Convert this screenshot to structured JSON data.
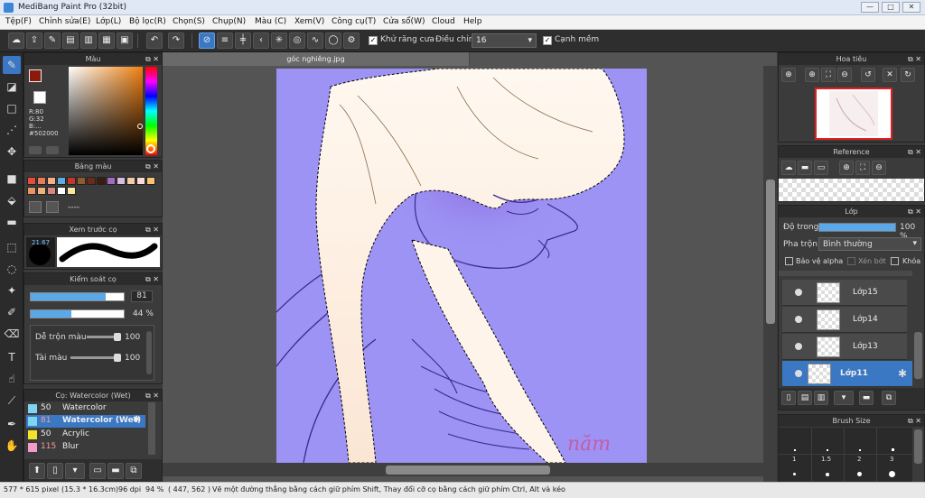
{
  "window": {
    "title": "MediBang Paint Pro (32bit)",
    "minimize": "—",
    "maximize": "□",
    "close": "✕"
  },
  "menu": [
    "Tệp(F)",
    "Chỉnh sửa(E)",
    "Lớp(L)",
    "Bộ lọc(R)",
    "Chọn(S)",
    "Chụp(N)",
    "Màu (C)",
    "Xem(V)",
    "Công cụ(T)",
    "Cửa sổ(W)",
    "Cloud",
    "Help"
  ],
  "toolbar": {
    "antialias_label": "Khử răng cưa",
    "adjust_label": "Điều chỉnh",
    "size_value": "16",
    "smooth_edge_label": "Cạnh mềm"
  },
  "color_panel": {
    "title": "Màu",
    "r": "R:80",
    "g": "G:32",
    "b": "B:...",
    "hex": "#502000",
    "fg_color": "#8b1a0a",
    "bg_color": "#ffffff"
  },
  "palette_panel": {
    "title": "Bảng màu",
    "colors": [
      "#e74c3c",
      "#e67e5a",
      "#f4b183",
      "#5dade2",
      "#c0392b",
      "#8e5b2a",
      "#6b2a1a",
      "#3d1c10",
      "#a569bd",
      "#d7bde2",
      "#f5cba7",
      "#fadbd8",
      "#f8c471",
      "#e59866",
      "#f0b27a",
      "#d98880",
      "#ffffff",
      "#f9e79f"
    ],
    "dashes": "----"
  },
  "brush_preview_panel": {
    "title": "Xem trước cọ",
    "size": "21.67"
  },
  "brush_control_panel": {
    "title": "Kiểm soát cọ",
    "size_value": "81",
    "opacity_value": "44 %",
    "mix_label": "Dễ trộn màu",
    "mix_value": "100",
    "amount_label": "Tài màu",
    "amount_value": "100",
    "size_fill": 0.81,
    "opacity_fill": 0.44
  },
  "brush_list_panel": {
    "title": "Cọ: Watercolor (Wet)",
    "items": [
      {
        "size": "50",
        "name": "Watercolor",
        "color": "#7fd4f2"
      },
      {
        "size": "81",
        "name": "Watercolor (Wet)",
        "color": "#7fd4f2"
      },
      {
        "size": "50",
        "name": "Acrylic",
        "color": "#f2e22a"
      },
      {
        "size": "115",
        "name": "Blur",
        "color": "#f49ac8"
      }
    ]
  },
  "canvas": {
    "doc_tab": "góc nghiêng.jpg",
    "signature": "năm"
  },
  "navigator_panel": {
    "title": "Hoa tiêu"
  },
  "reference_panel": {
    "title": "Reference"
  },
  "layer_panel": {
    "title": "Lớp",
    "opacity_label": "Độ trong",
    "opacity_value": "100 %",
    "opacity_fill": 1.0,
    "blend_label": "Pha trộn",
    "blend_value": "Bình thường",
    "protect_alpha": "Bảo vệ alpha",
    "clipping": "Xén bớt",
    "lock": "Khóa",
    "layers": [
      {
        "name": "Lớp15"
      },
      {
        "name": "Lớp14"
      },
      {
        "name": "Lớp13"
      },
      {
        "name": "Lớp11"
      }
    ]
  },
  "brush_size_panel": {
    "title": "Brush Size",
    "sizes": [
      "1",
      "1.5",
      "2",
      "3"
    ]
  },
  "status": {
    "size": "577 * 615 pixel",
    "cm": "(15.3 * 16.3cm)",
    "dpi": "96 dpi",
    "zoom": "94 %",
    "coords": "( 447, 562 )",
    "hint": "Vẽ một đường thẳng bằng cách giữ phím Shift, Thay đổi cỡ cọ bằng cách giữ phím Ctrl, Alt và kéo"
  }
}
